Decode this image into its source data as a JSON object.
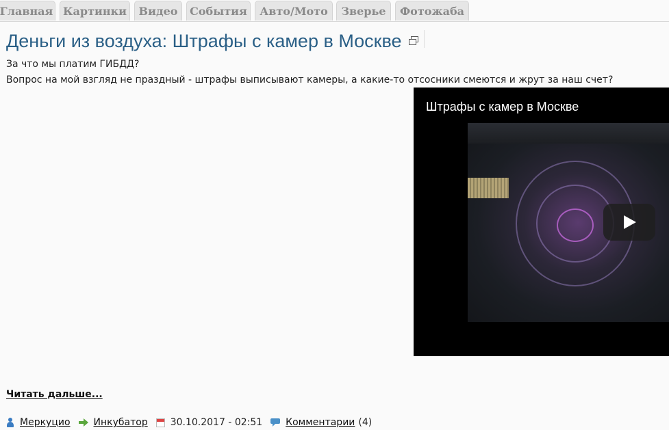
{
  "nav": {
    "tabs": [
      "Главная",
      "Картинки",
      "Видео",
      "События",
      "Авто/Мото",
      "Зверье",
      "Фотожаба"
    ]
  },
  "article": {
    "title": "Деньги из воздуха: Штрафы с камер в Москве",
    "line1": "За что мы платим ГИБДД?",
    "line2": "Вопрос на мой взгляд не праздный - штрафы выписывают камеры, а какие-то отсосники смеются и жрут за наш счет?",
    "video_title": "Штрафы с камер в Москве",
    "read_more": "Читать дальше...",
    "author": "Меркуцио",
    "section": "Инкубатор",
    "date": "30.10.2017 - 02:51",
    "comments_label": "Комментарии",
    "comments_count": "(4)"
  },
  "colors": {
    "title": "#2a5f86",
    "tab_bg": "#e6e6e6",
    "tab_text": "#8a8a8a"
  }
}
